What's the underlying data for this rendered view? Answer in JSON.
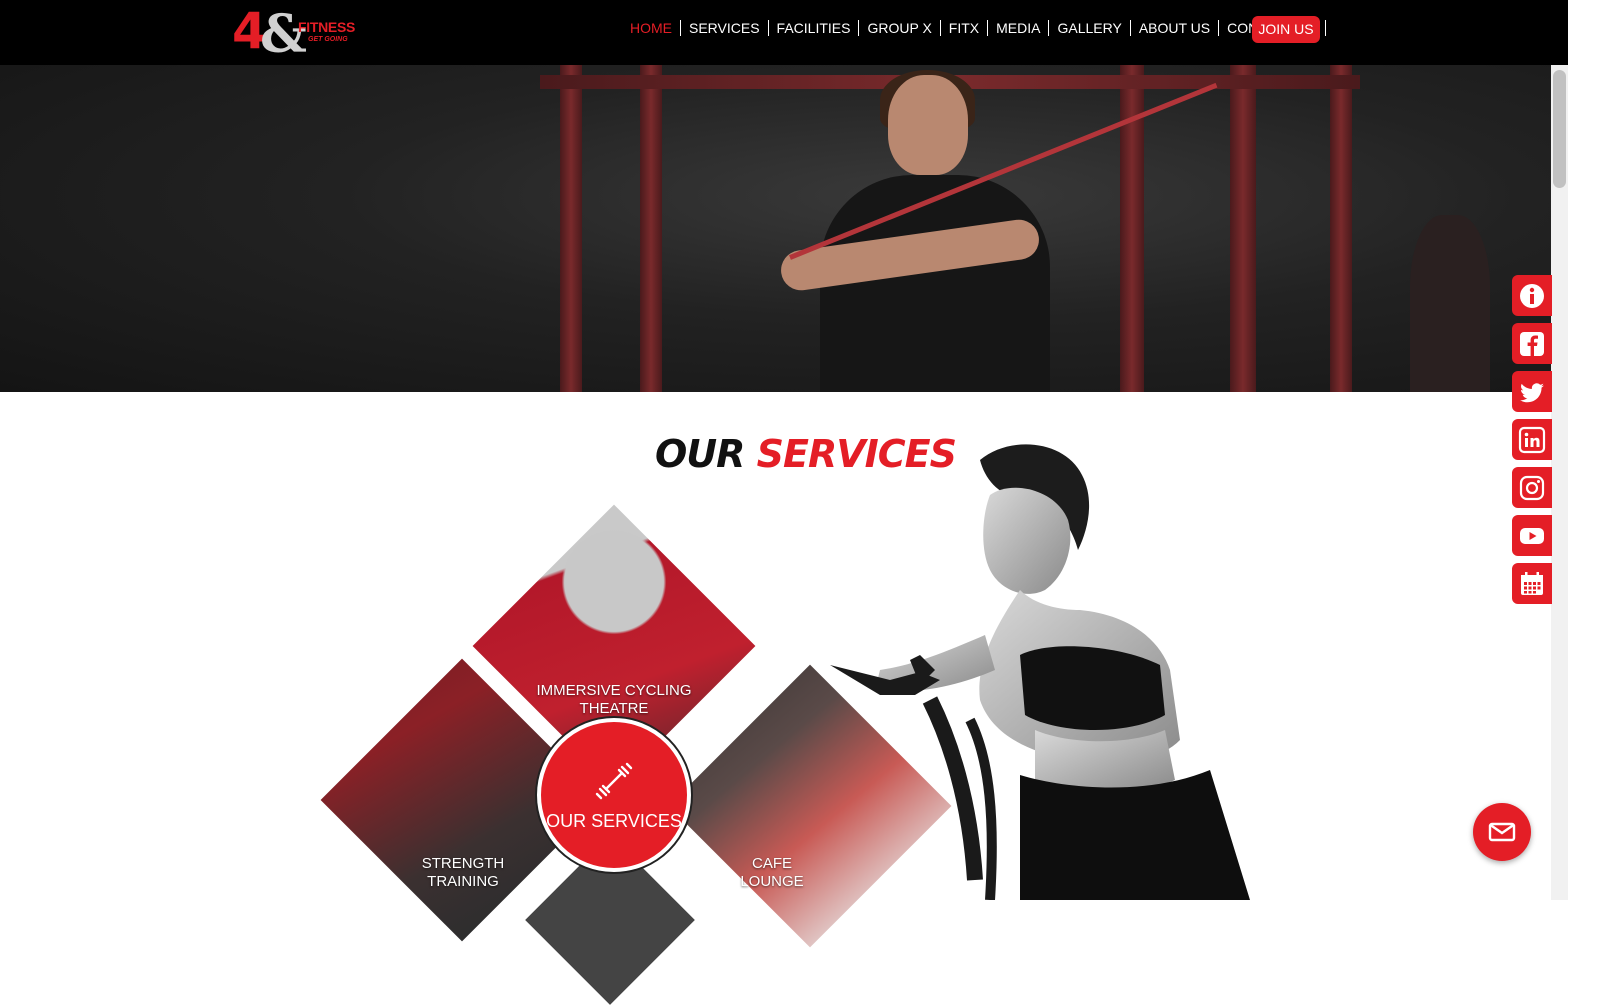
{
  "brand": {
    "logo_number": "4",
    "logo_amp": "&",
    "logo_name": "FITNESS",
    "logo_tagline": "GET GOING"
  },
  "nav": {
    "items": [
      "HOME",
      "SERVICES",
      "FACILITIES",
      "GROUP X",
      "FITX",
      "MEDIA",
      "GALLERY",
      "ABOUT US",
      "CONTACT US"
    ],
    "active_index": 0,
    "cta_label": "JOIN US"
  },
  "social": [
    "info-icon",
    "facebook-icon",
    "twitter-icon",
    "linkedin-icon",
    "instagram-icon",
    "youtube-icon",
    "calendar-icon"
  ],
  "services": {
    "title_part1": "OUR",
    "title_part2": "SERVICES",
    "center_label": "OUR SERVICES",
    "center_icon": "dumbbell-icon",
    "tiles": [
      {
        "label_line1": "IMMERSIVE CYCLING",
        "label_line2": "THEATRE"
      },
      {
        "label_line1": "STRENGTH",
        "label_line2": "TRAINING"
      },
      {
        "label_line1": "CAFE",
        "label_line2": "LOUNGE"
      }
    ]
  },
  "fab": {
    "icon": "mail-icon"
  },
  "colors": {
    "accent": "#e41e26",
    "nav_bg": "#000000",
    "text_dark": "#111111"
  }
}
